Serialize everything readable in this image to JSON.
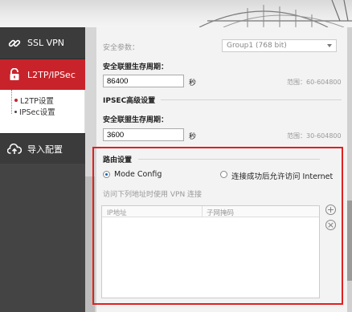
{
  "sidebar": {
    "items": [
      {
        "label": "SSL VPN",
        "icon": "link-icon"
      },
      {
        "label": "L2TP/IPSec",
        "icon": "lock-icon"
      },
      {
        "label": "导入配置",
        "icon": "cloud-upload-icon"
      }
    ],
    "submenu": [
      {
        "label": "L2TP设置"
      },
      {
        "label": "IPSec设置"
      }
    ]
  },
  "security": {
    "param_label": "安全参数：",
    "param_value": "Group1 (768 bit)",
    "lifetime_label": "安全联盟生存周期：",
    "lifetime_value": "86400",
    "unit": "秒",
    "range": "范围：60-604800"
  },
  "ipsec_advanced": {
    "title": "IPSEC高级设置",
    "lifetime_label": "安全联盟生存周期：",
    "lifetime_value": "3600",
    "unit": "秒",
    "range": "范围：30-604800"
  },
  "routing": {
    "title": "路由设置",
    "option_mode_config": "Mode Config",
    "option_internet": "连接成功后允许访问 Internet",
    "selected": "Mode Config",
    "hint": "访问下列地址时使用 VPN 连接",
    "columns": [
      "IP地址",
      "子网掩码"
    ],
    "rows": []
  },
  "colors": {
    "accent": "#c8232b",
    "sidebar_bg": "#3b3b3b",
    "highlight_border": "#e0201f"
  }
}
